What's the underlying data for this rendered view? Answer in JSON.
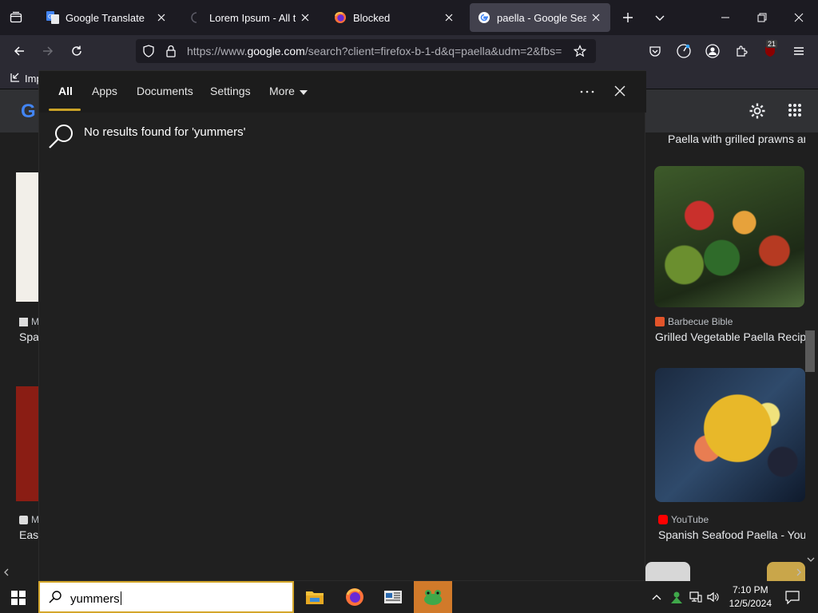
{
  "browser": {
    "tabs": [
      {
        "title": "Google Translate",
        "icon": "google-translate-icon"
      },
      {
        "title": "Lorem Ipsum - All the facts - Lipsum generator",
        "icon": "loading-icon"
      },
      {
        "title": "Blocked",
        "icon": "firefox-icon"
      },
      {
        "title": "paella - Google Search",
        "icon": "google-icon",
        "active": true
      }
    ],
    "url_prefix": "https://www.",
    "url_domain": "google.com",
    "url_rest": "/search?client=firefox-b-1-d&q=paella&udm=2&fbs=",
    "bookmark_label": "Imp",
    "extension_badge": "21"
  },
  "google": {
    "left_source_1": "M",
    "left_title_1": "Spa",
    "left_source_2": "M",
    "left_title_2": "Eas",
    "right_top_title": "Paella with grilled prawns and",
    "right_source_1": "Barbecue Bible",
    "right_title_1": "Grilled Vegetable Paella Recipe",
    "right_source_2": "YouTube",
    "right_title_2": "Spanish Seafood Paella - YouTube"
  },
  "search_panel": {
    "tabs": [
      "All",
      "Apps",
      "Documents",
      "Settings",
      "More"
    ],
    "active_tab": "All",
    "no_results": "No results found for 'yummers'"
  },
  "taskbar": {
    "search_value": "yummers",
    "time": "7:10 PM",
    "date": "12/5/2024"
  },
  "colors": {
    "accent": "#d4a62a",
    "panel_bg": "#202020",
    "browser_bg": "#1c1b22"
  }
}
